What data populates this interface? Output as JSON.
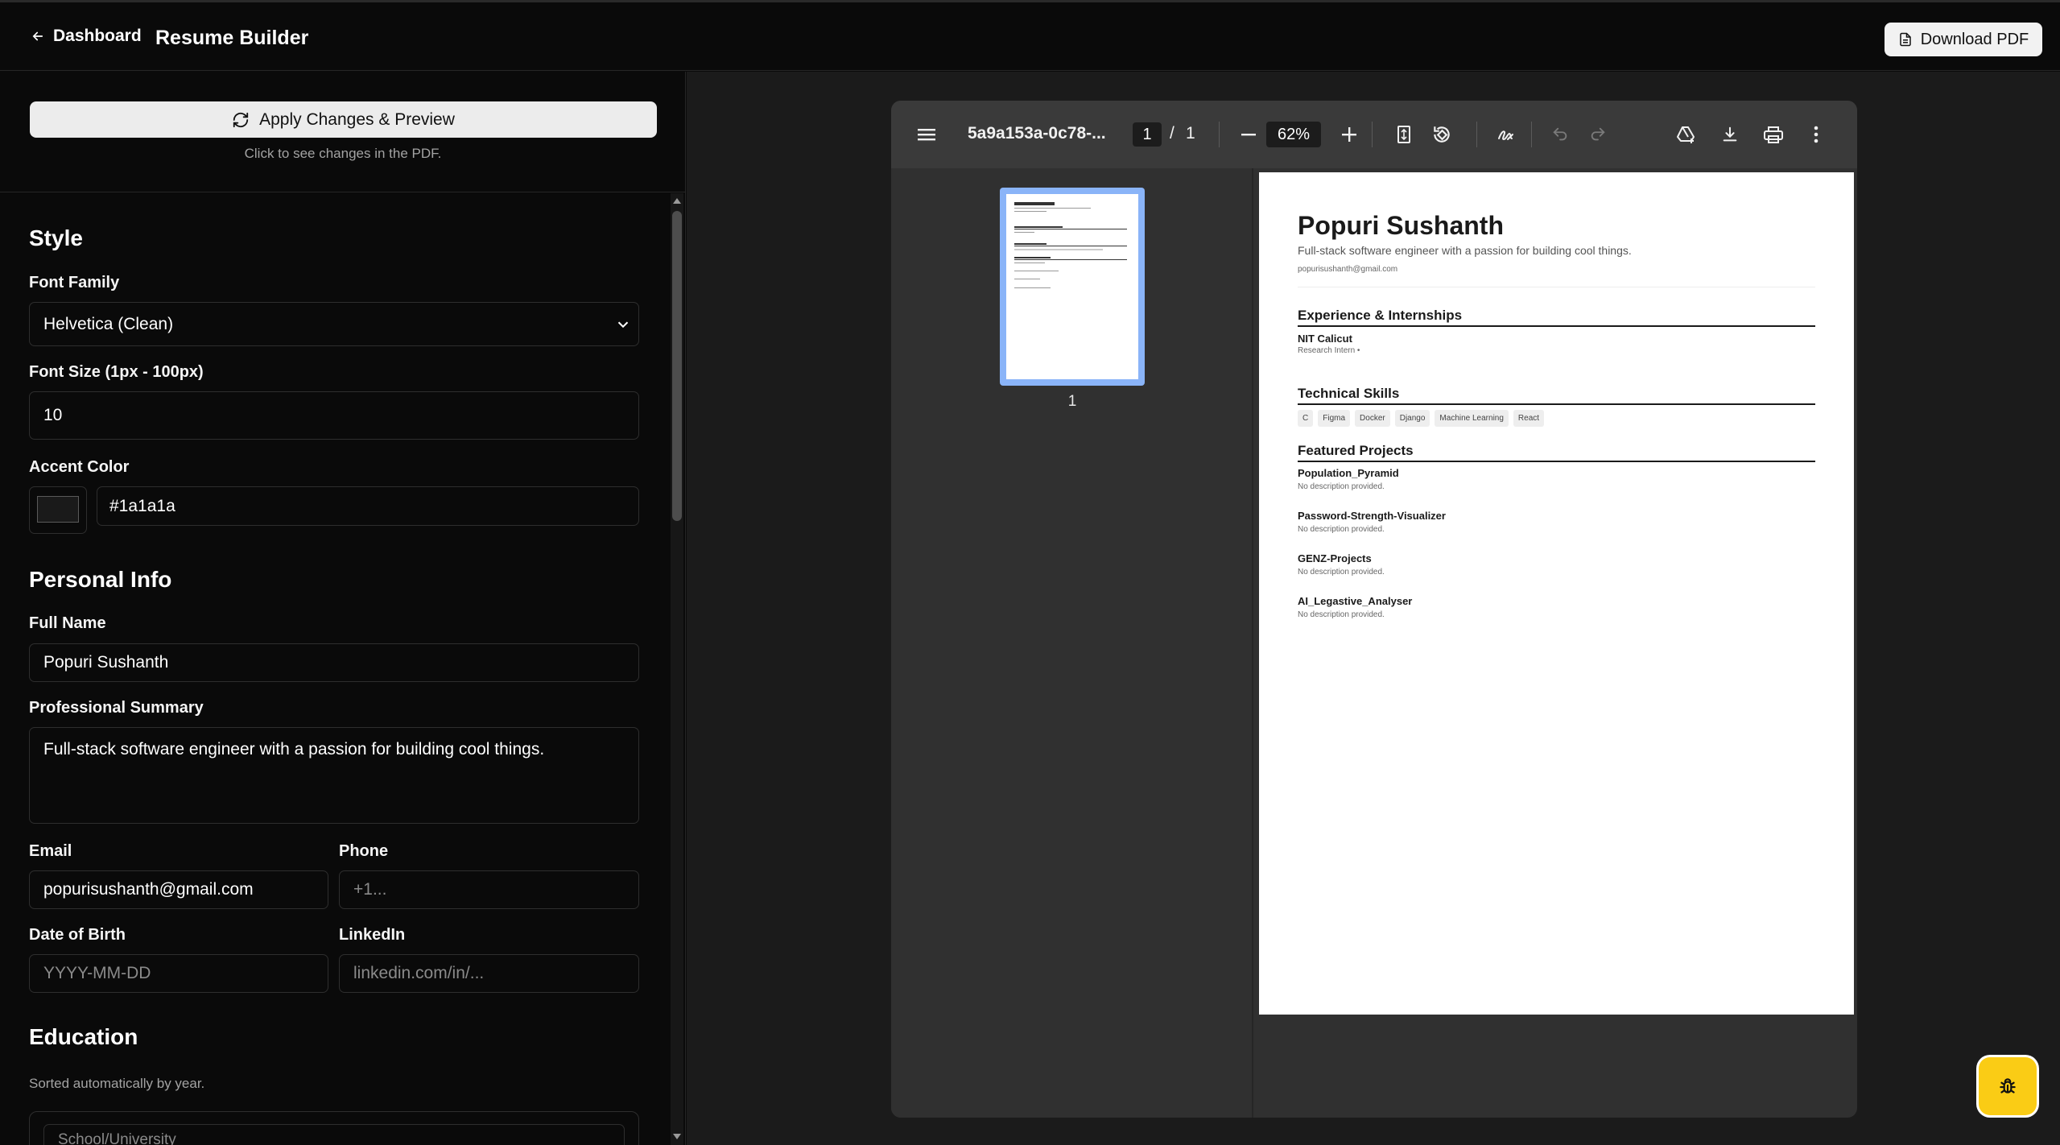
{
  "header": {
    "back_label": "Dashboard",
    "title": "Resume Builder",
    "download_label": "Download PDF"
  },
  "apply": {
    "label": "Apply Changes & Preview",
    "hint": "Click to see changes in the PDF."
  },
  "style": {
    "title": "Style",
    "font_family_label": "Font Family",
    "font_family_value": "Helvetica (Clean)",
    "font_size_label": "Font Size (1px - 100px)",
    "font_size_value": "10",
    "accent_label": "Accent Color",
    "accent_value": "#1a1a1a",
    "accent_color": "#1a1a1a"
  },
  "personal": {
    "title": "Personal Info",
    "full_name_label": "Full Name",
    "full_name_value": "Popuri Sushanth",
    "summary_label": "Professional Summary",
    "summary_value": "Full-stack software engineer with a passion for building cool things.",
    "email_label": "Email",
    "email_value": "popurisushanth@gmail.com",
    "phone_label": "Phone",
    "phone_placeholder": "+1...",
    "dob_label": "Date of Birth",
    "dob_placeholder": "YYYY-MM-DD",
    "linkedin_label": "LinkedIn",
    "linkedin_placeholder": "linkedin.com/in/..."
  },
  "education": {
    "title": "Education",
    "hint": "Sorted automatically by year.",
    "school_placeholder": "School/University"
  },
  "viewer": {
    "filename": "5a9a153a-0c78-...",
    "page_current": "1",
    "page_total": "1",
    "zoom": "62%",
    "thumb_label": "1"
  },
  "resume": {
    "name": "Popuri Sushanth",
    "summary": "Full-stack software engineer with a passion for building cool things.",
    "email": "popurisushanth@gmail.com",
    "experience_title": "Experience & Internships",
    "experience": [
      {
        "org": "NIT Calicut",
        "role": "Research Intern •"
      }
    ],
    "skills_title": "Technical Skills",
    "skills": [
      "C",
      "Figma",
      "Docker",
      "Django",
      "Machine Learning",
      "React"
    ],
    "projects_title": "Featured Projects",
    "projects": [
      {
        "name": "Population_Pyramid",
        "desc": "No description provided."
      },
      {
        "name": "Password-Strength-Visualizer",
        "desc": "No description provided."
      },
      {
        "name": "GENZ-Projects",
        "desc": "No description provided."
      },
      {
        "name": "AI_Legastive_Analyser",
        "desc": "No description provided."
      }
    ]
  }
}
